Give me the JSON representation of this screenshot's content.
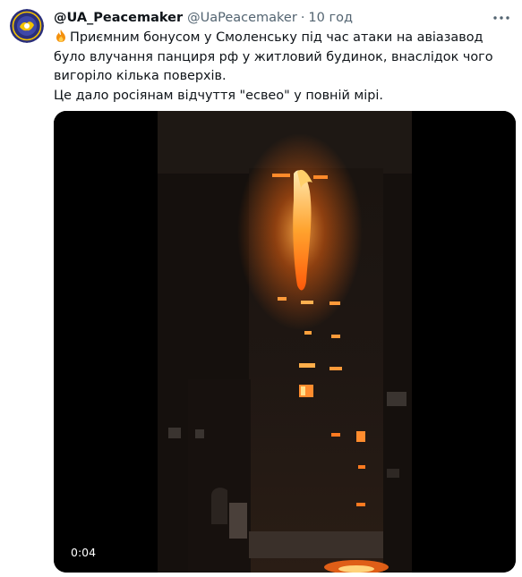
{
  "tweet": {
    "author": {
      "display_name": "@UA_Peacemaker",
      "handle": "@UaPeacemaker",
      "avatar_icon": "ua-peacemaker-logo"
    },
    "separator": "·",
    "time": "10 год",
    "text_line_1": "Приємним бонусом у Смоленську під час атаки на авіазавод було влучання панциря рф у житловий будинок, внаслідок чого вигоріло кілька поверхів.",
    "text_line_2": "Це дало росіянам відчуття \"есвео\" у повній мірі.",
    "emoji": "fire-emoji",
    "media": {
      "type": "video",
      "duration": "0:04"
    }
  },
  "colors": {
    "text_primary": "#0f1419",
    "text_secondary": "#536471",
    "fire": "#ff7a1a",
    "video_bg": "#000000"
  }
}
